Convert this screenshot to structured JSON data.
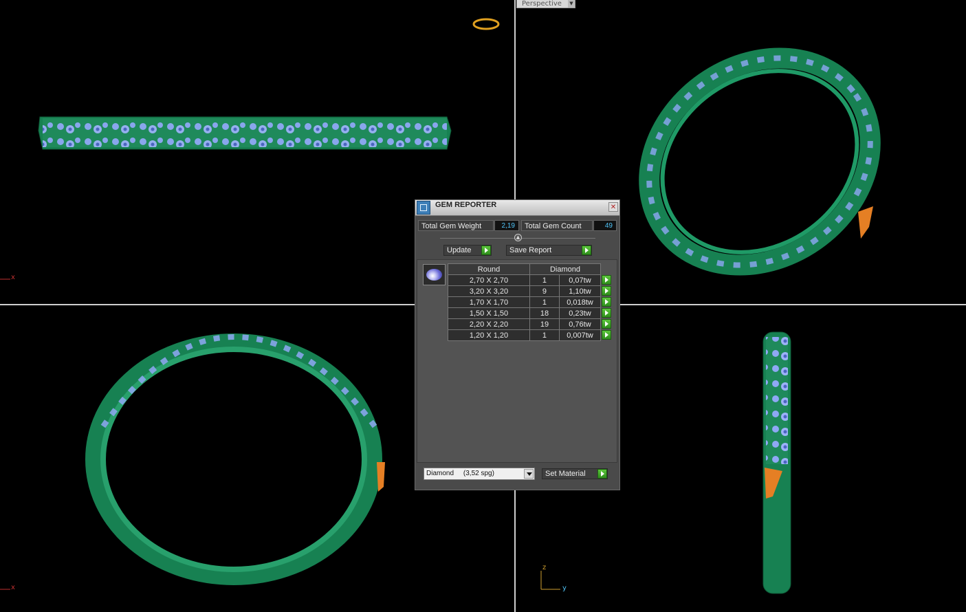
{
  "viewport": {
    "label": "Perspective",
    "axis_x_top_left": "x",
    "axis_x_bottom_left": "x",
    "axis_z": "z",
    "axis_y": "y"
  },
  "colors": {
    "metal": "#1f8a5b",
    "metal_dark": "#15663f",
    "gem_blue": "#8fa8f5",
    "accent_orange": "#e57f24",
    "value_text": "#4fc3f7"
  },
  "panel": {
    "title": "GEM REPORTER",
    "close_icon": "close-icon",
    "total_weight_label": "Total Gem Weight",
    "total_weight_value": "2,19",
    "total_count_label": "Total Gem Count",
    "total_count_value": "49",
    "update_label": "Update",
    "save_report_label": "Save Report",
    "table": {
      "headers": [
        "Round",
        "Diamond"
      ],
      "rows": [
        {
          "size": "2,70 X 2,70",
          "count": "1",
          "weight": "0,07tw"
        },
        {
          "size": "3,20 X 3,20",
          "count": "9",
          "weight": "1,10tw"
        },
        {
          "size": "1,70 X 1,70",
          "count": "1",
          "weight": "0,018tw"
        },
        {
          "size": "1,50 X 1,50",
          "count": "18",
          "weight": "0,23tw"
        },
        {
          "size": "2,20 X 2,20",
          "count": "19",
          "weight": "0,76tw"
        },
        {
          "size": "1,20 X 1,20",
          "count": "1",
          "weight": "0,007tw"
        }
      ]
    },
    "material_select": "Diamond     (3,52 spg)",
    "set_material_label": "Set Material"
  }
}
